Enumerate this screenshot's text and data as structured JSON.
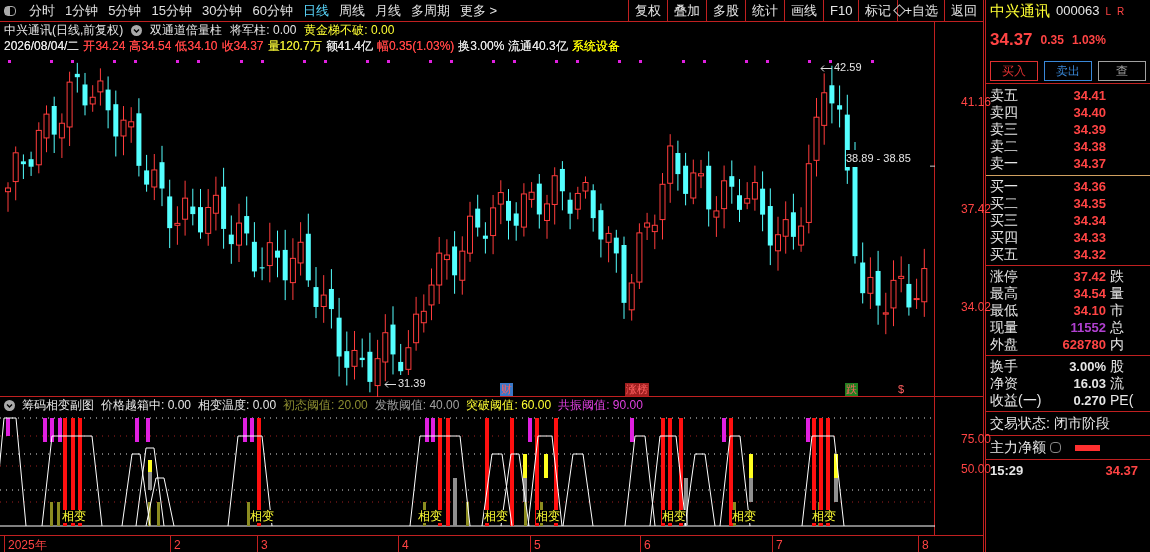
{
  "toolbar": {
    "periods": [
      {
        "label": "分时",
        "selected": false
      },
      {
        "label": "1分钟",
        "selected": false
      },
      {
        "label": "5分钟",
        "selected": false
      },
      {
        "label": "15分钟",
        "selected": false
      },
      {
        "label": "30分钟",
        "selected": false
      },
      {
        "label": "60分钟",
        "selected": false
      },
      {
        "label": "日线",
        "selected": true
      },
      {
        "label": "周线",
        "selected": false
      },
      {
        "label": "月线",
        "selected": false
      },
      {
        "label": "多周期",
        "selected": false
      }
    ],
    "more": "更多 >",
    "actions": [
      "复权",
      "叠加",
      "多股",
      "统计",
      "画线",
      "F10",
      "标记",
      "+自选",
      "返回"
    ]
  },
  "main_chart": {
    "title": "中兴通讯(日线,前复权)",
    "indicator": "双通道倍量柱",
    "fields": [
      {
        "text": "将军柱: 0.00",
        "color": "#e6e6e6"
      },
      {
        "text": "黄金梯不破: 0.00",
        "color": "#ffff33"
      }
    ],
    "quote_line": [
      {
        "text": "2026/08/04/二",
        "color": "#e6e6e6"
      },
      {
        "text": "开34.24",
        "color": "#ff4444"
      },
      {
        "text": "高34.54",
        "color": "#ff4444"
      },
      {
        "text": "低34.10",
        "color": "#ff4444"
      },
      {
        "text": "收34.37",
        "color": "#ff4444"
      },
      {
        "text": "量120.7万",
        "color": "#e6e633"
      },
      {
        "text": "额41.4亿",
        "color": "#e6e6e6"
      },
      {
        "text": "幅0.35(1.03%)",
        "color": "#ff4444"
      },
      {
        "text": "换3.00%",
        "color": "#e6e6e6"
      },
      {
        "text": "流通40.3亿",
        "color": "#e6e6e6"
      },
      {
        "text": "系统设备",
        "color": "#ffff00"
      }
    ],
    "price_ticks": [
      "41.16",
      "37.42",
      "34.02"
    ],
    "high_label": "42.59",
    "range_label": "38.89 - 38.85",
    "low_label": "31.39",
    "markers": [
      {
        "text": "财",
        "color": "#3a78c8"
      },
      {
        "text": "涨榜",
        "color": "#a02020"
      },
      {
        "text": "跌",
        "color": "#208020"
      },
      {
        "text": "$",
        "color": "#000000"
      }
    ]
  },
  "indicator": {
    "title": "筹码相变副图",
    "fields": [
      {
        "text": "价格越箱中: 0.00",
        "color": "#e6e6e6"
      },
      {
        "text": "相变温度: 0.00",
        "color": "#e6e6e6"
      },
      {
        "text": "初态阈值: 20.00",
        "color": "#8c8c30"
      },
      {
        "text": "发散阈值: 40.00",
        "color": "#a0a0a0"
      },
      {
        "text": "突破阈值: 60.00",
        "color": "#ffff33"
      },
      {
        "text": "共振阈值: 90.00",
        "color": "#e040e0"
      }
    ],
    "ticks": [
      "75.00",
      "50.00"
    ],
    "labels": [
      "相变",
      "相变",
      "相变",
      "相变",
      "相变",
      "相变",
      "相变",
      "相变"
    ]
  },
  "time_axis": [
    "2025年",
    "2",
    "3",
    "4",
    "5",
    "6",
    "7",
    "8"
  ],
  "quote_panel": {
    "name": "中兴通讯",
    "code": "000063",
    "flags": [
      "L",
      "R"
    ],
    "price": "34.37",
    "change": "0.35",
    "change_pct": "1.03%",
    "buttons": [
      {
        "label": "买入",
        "color": "#e03030"
      },
      {
        "label": "卖出",
        "color": "#3a88d8"
      },
      {
        "label": "查",
        "color": "#a0a0a0"
      }
    ],
    "asks": [
      {
        "label": "卖五",
        "price": "34.41"
      },
      {
        "label": "卖四",
        "price": "34.40"
      },
      {
        "label": "卖三",
        "price": "34.39"
      },
      {
        "label": "卖二",
        "price": "34.38"
      },
      {
        "label": "卖一",
        "price": "34.37"
      }
    ],
    "bids": [
      {
        "label": "买一",
        "price": "34.36"
      },
      {
        "label": "买二",
        "price": "34.35"
      },
      {
        "label": "买三",
        "price": "34.34"
      },
      {
        "label": "买四",
        "price": "34.33"
      },
      {
        "label": "买五",
        "price": "34.32"
      }
    ],
    "stats": [
      {
        "label": "涨停",
        "value": "37.42",
        "color": "#ff4444",
        "extra": "跌"
      },
      {
        "label": "最高",
        "value": "34.54",
        "color": "#ff4444",
        "extra": "量"
      },
      {
        "label": "最低",
        "value": "34.10",
        "color": "#ff4444",
        "extra": "市"
      },
      {
        "label": "现量",
        "value": "11552",
        "color": "#b040d0",
        "extra": "总"
      },
      {
        "label": "外盘",
        "value": "628780",
        "color": "#ff4444",
        "extra": "内"
      }
    ],
    "finance": [
      {
        "label": "换手",
        "value": "3.00%",
        "extra": "股"
      },
      {
        "label": "净资",
        "value": "16.03",
        "extra": "流"
      },
      {
        "label": "收益(一)",
        "value": "0.270",
        "extra": "PE("
      }
    ],
    "status": "交易状态: 闭市阶段",
    "net_flow": "主力净额",
    "last_time": "15:29",
    "last_price": "34.37"
  }
}
